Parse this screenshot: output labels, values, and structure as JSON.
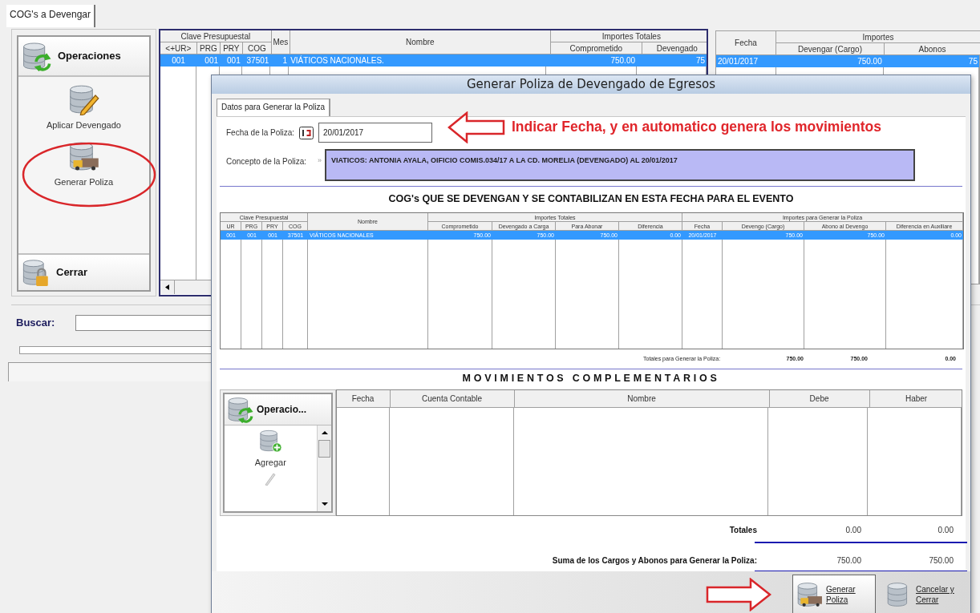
{
  "tabs": [
    {
      "label": "COG's a Devengar",
      "selected": true
    }
  ],
  "side_panel": {
    "header": "Operaciones",
    "items": [
      {
        "label": "Aplicar Devengado",
        "kind": "edit"
      },
      {
        "label": "Generar Poliza",
        "kind": "truck"
      }
    ],
    "footer": "Cerrar"
  },
  "main_table": {
    "groups": [
      {
        "label": "Clave Presupuestal",
        "columns": [
          "<+UR>",
          "PRG",
          "PRY",
          "COG"
        ]
      },
      {
        "columns": [
          "Mes"
        ]
      },
      {
        "columns": [
          "Nombre"
        ]
      },
      {
        "label": "Importes Totales",
        "columns": [
          "Comprometido",
          "Devengado"
        ]
      }
    ],
    "rows": [
      {
        "cells": [
          "001",
          "001",
          "001",
          "37501",
          "1",
          "VIÁTICOS NACIONALES.",
          "750.00",
          "75"
        ],
        "selected": true
      }
    ]
  },
  "right_table": {
    "groups": [
      {
        "columns": [
          "Fecha"
        ]
      },
      {
        "label": "Importes",
        "columns": [
          "Devengar (Cargo)",
          "Abonos"
        ]
      }
    ],
    "rows": [
      {
        "cells": [
          "20/01/2017",
          "750.00",
          "75"
        ],
        "selected": true
      }
    ]
  },
  "search": {
    "label": "Buscar:"
  },
  "dialog": {
    "title": "Generar Poliza de Devengado de Egresos",
    "tabs": [
      {
        "label": "Datos para Generar la Poliza",
        "selected": true
      }
    ],
    "date_field": {
      "label": "Fecha de la Poliza:",
      "value": "20/01/2017"
    },
    "concept_field": {
      "label": "Concepto de la Poliza:",
      "marker": "»",
      "value": "VIATICOS: ANTONIA AYALA, OIFICIO COMIS.034/17 A LA CD. MORELIA (DEVENGADO) AL 20/01/2017"
    },
    "heading": "COG's QUE SE DEVENGAN Y SE CONTABILIZAN EN ESTA FECHA PARA EL EVENTO",
    "cog_table": {
      "groups": [
        {
          "label": "Clave Presupuestal",
          "columns": [
            "UR",
            "PRG",
            "PRY",
            "COG"
          ]
        },
        {
          "columns": [
            "Nombre"
          ]
        },
        {
          "label": "Importes Totales",
          "columns": [
            "Comprometido",
            "Devengado a Carga",
            "Para Abonar",
            "Diferencia"
          ]
        },
        {
          "label": "Importes para Generar la Poliza",
          "columns": [
            "Fecha",
            "Devengo (Cargo)",
            "Abono al Devengo",
            "Diferencia en Auxiliare"
          ]
        }
      ],
      "rows": [
        {
          "cells": [
            "001",
            "001",
            "001",
            "37501",
            "VIÁTICOS NACIONALES",
            "750.00",
            "750.00",
            "750.00",
            "0.00",
            "20/01/2017",
            "750.00",
            "750.00",
            "0.00"
          ],
          "selected": true
        }
      ],
      "totals": {
        "label": "Totales para Generar la Poliza:",
        "values": [
          "750.00",
          "750.00",
          "0.00"
        ]
      }
    },
    "movements_heading": "MOVIMIENTOS COMPLEMENTARIOS",
    "ops_panel": {
      "header": "Operacio...",
      "items": [
        {
          "label": "Agregar",
          "kind": "add"
        },
        {
          "kind": "edit"
        }
      ]
    },
    "movements_table": {
      "groups": [
        {
          "columns": [
            "Fecha"
          ]
        },
        {
          "columns": [
            "Cuenta Contable"
          ]
        },
        {
          "columns": [
            "Nombre"
          ]
        },
        {
          "columns": [
            "Debe"
          ]
        },
        {
          "columns": [
            "Haber"
          ]
        }
      ]
    },
    "totals": {
      "label": "Totales",
      "debe": "0.00",
      "haber": "0.00"
    },
    "sum": {
      "label": "Suma de los Cargos y Abonos para Generar la Poliza:",
      "debe": "750.00",
      "haber": "750.00"
    },
    "buttons": [
      {
        "label": "Generar Poliza",
        "kind": "generate"
      },
      {
        "label": "Cancelar y Cerrar",
        "kind": "cancel"
      }
    ]
  },
  "annotation": {
    "note": "Indicar Fecha, y en automatico genera los movimientos"
  }
}
